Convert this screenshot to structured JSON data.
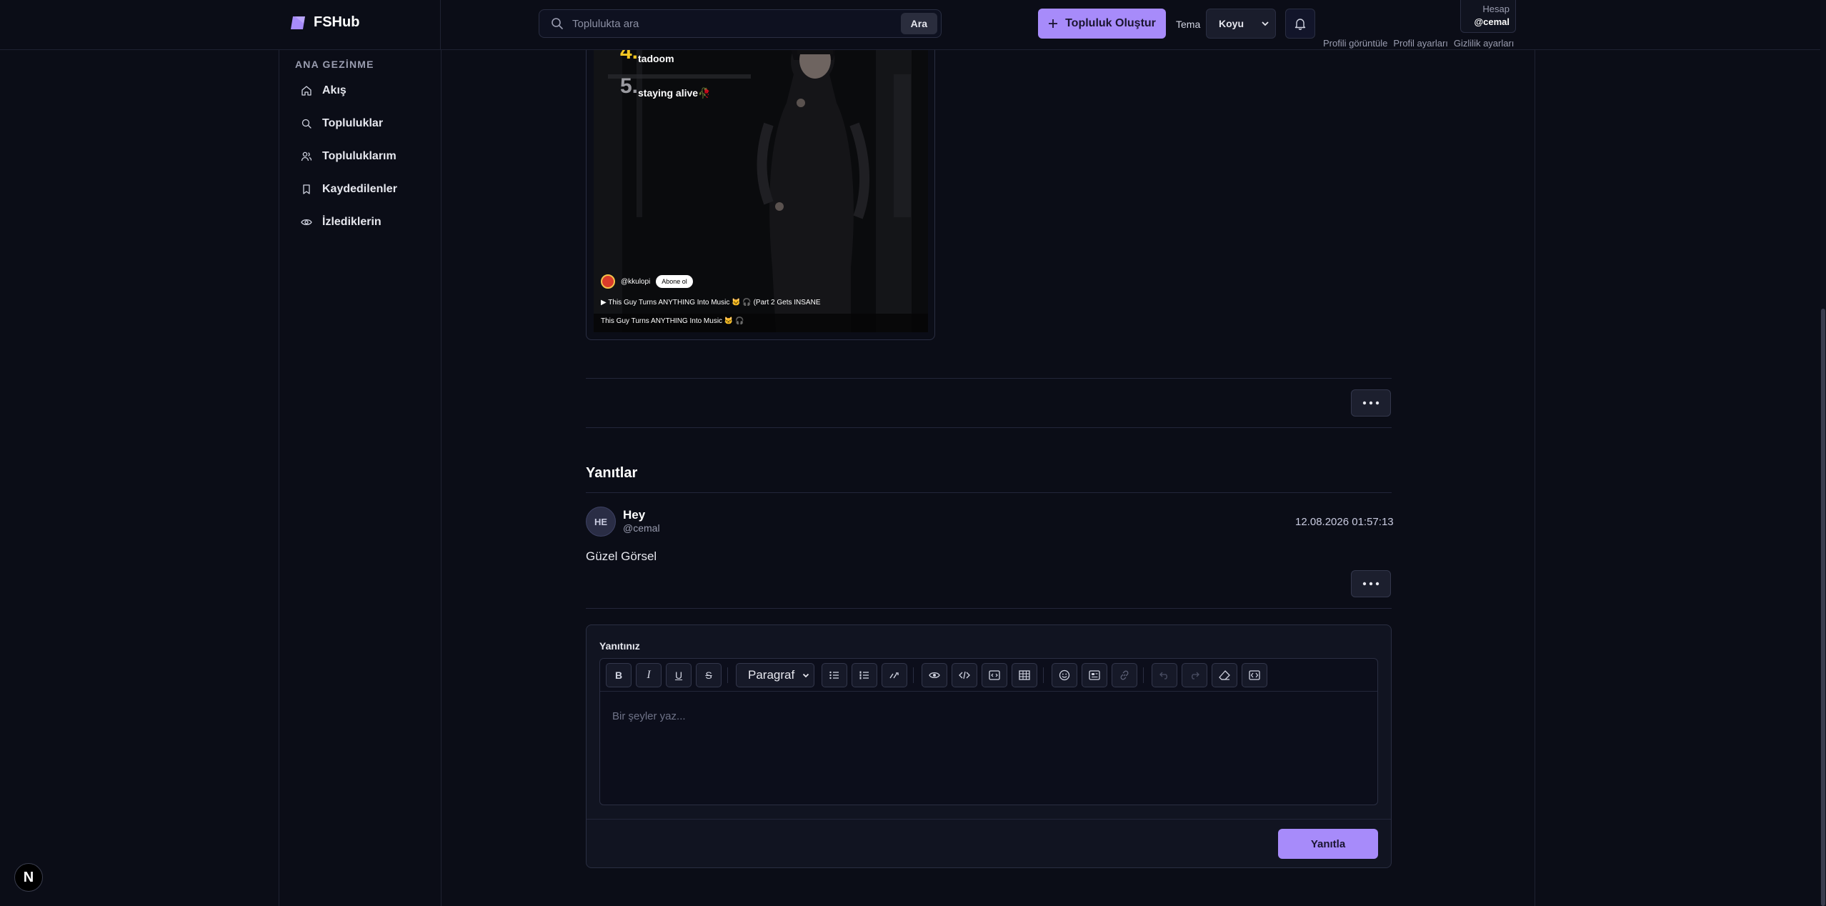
{
  "app": {
    "name": "FSHub",
    "logo_icon": "fshub-logo-icon"
  },
  "search": {
    "placeholder": "Toplulukta ara",
    "button": "Ara"
  },
  "header": {
    "create_button": "Topluluk Oluştur",
    "theme_label": "Tema",
    "theme_value": "Koyu",
    "account_title": "Hesap",
    "account_user": "@cemal",
    "account_links": [
      "Profili görüntüle",
      "Profil ayarları",
      "Gizlilik ayarları"
    ]
  },
  "sidebar": {
    "title": "ANA GEZİNME",
    "items": [
      {
        "label": "Akış",
        "icon": "home-icon"
      },
      {
        "label": "Topluluklar",
        "icon": "search-icon"
      },
      {
        "label": "Topluluklarım",
        "icon": "users-icon"
      },
      {
        "label": "Kaydedilenler",
        "icon": "bookmark-icon"
      },
      {
        "label": "İzlediklerin",
        "icon": "eye-icon"
      }
    ]
  },
  "video": {
    "overlay": [
      {
        "rank": "4.",
        "text": "tadoom"
      },
      {
        "rank": "5.",
        "text": "staying alive🥀"
      }
    ],
    "channel": "@kkulopi",
    "subscribe": "Abone ol",
    "title_line": "▶ This Guy Turns ANYTHING Into Music 🐱 🎧 (Part 2 Gets INSANE",
    "caption": "This Guy Turns ANYTHING Into Music 🐱 🎧"
  },
  "replies": {
    "title": "Yanıtlar",
    "items": [
      {
        "initials": "HE",
        "name": "Hey",
        "handle": "@cemal",
        "date": "12.08.2026 01:57:13",
        "body": "Güzel Görsel"
      }
    ]
  },
  "editor": {
    "label": "Yanıtınız",
    "format_value": "Paragraf",
    "placeholder": "Bir şeyler yaz...",
    "submit": "Yanıtla"
  },
  "badge": {
    "letter": "N"
  },
  "colors": {
    "accent": "#a78bfa",
    "background": "#0b0d17"
  }
}
